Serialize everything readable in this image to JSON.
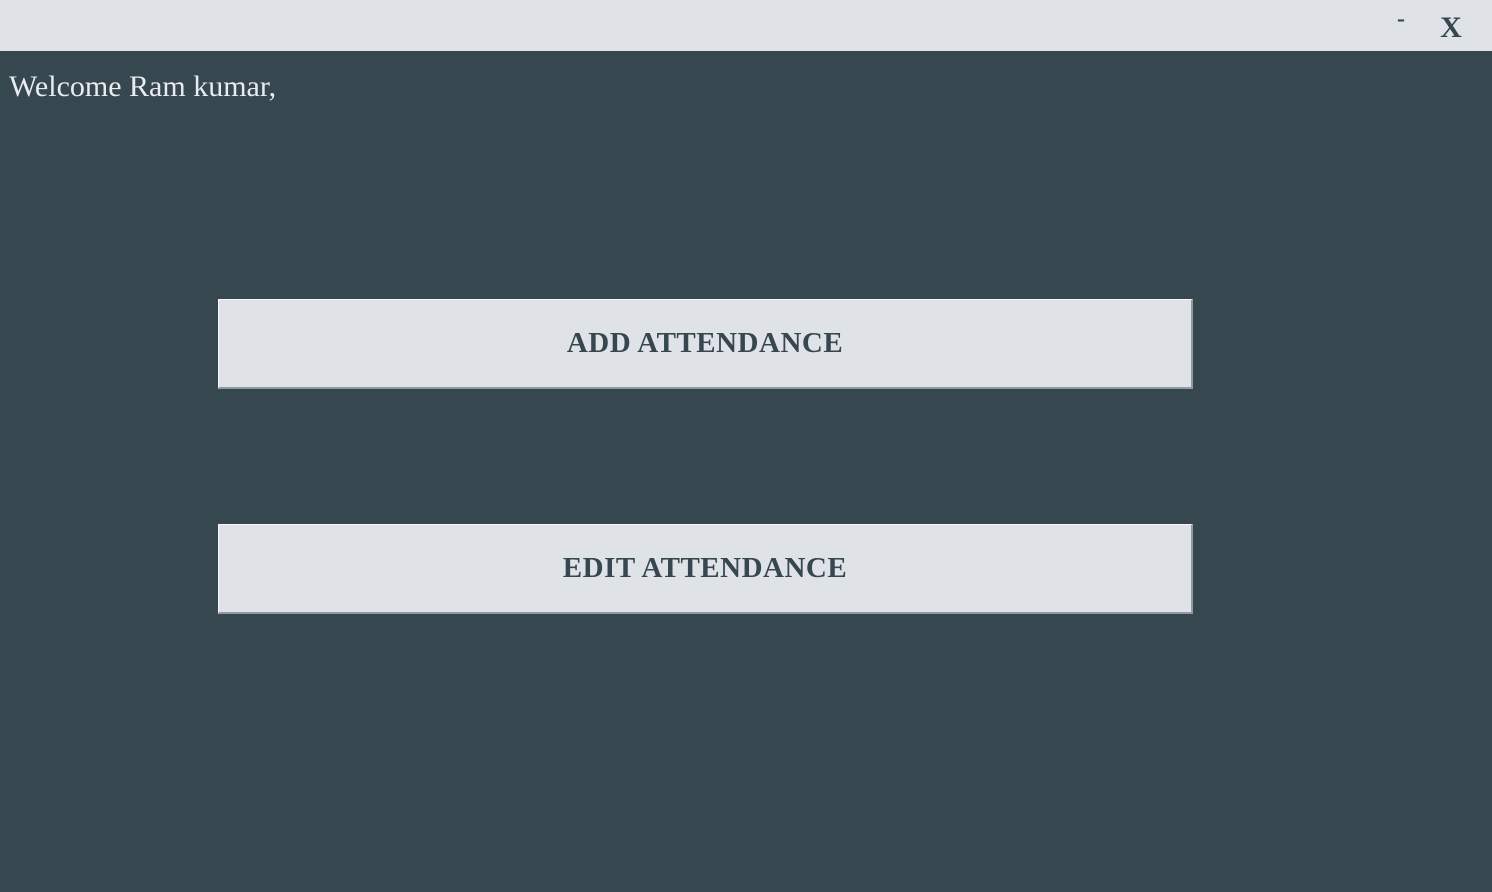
{
  "window": {
    "minimize_label": "-",
    "close_label": "X"
  },
  "main": {
    "welcome_text": "Welcome Ram kumar,",
    "add_attendance_label": "ADD ATTENDANCE",
    "edit_attendance_label": "EDIT ATTENDANCE"
  },
  "colors": {
    "background": "#36474f",
    "titlebar": "#dfe3e7",
    "button_bg": "#dfe3e7",
    "button_text": "#36474f",
    "welcome_text": "#e8ecef"
  }
}
